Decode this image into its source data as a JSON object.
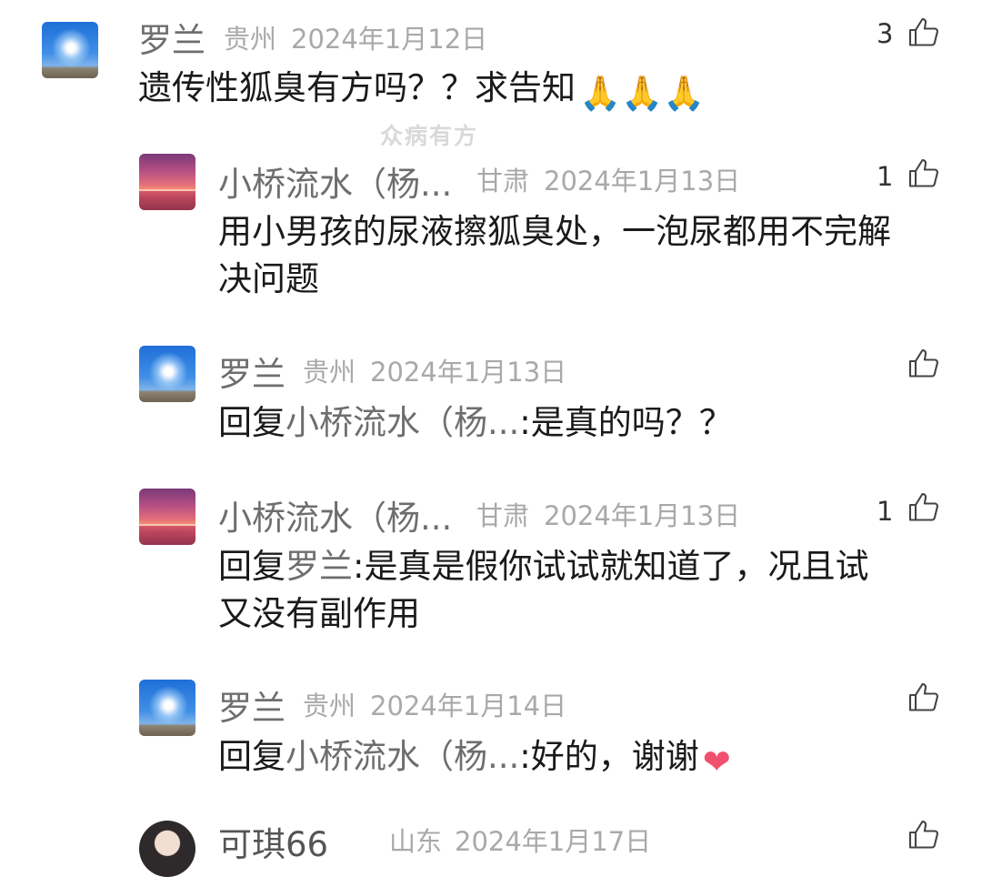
{
  "watermark": "众病有方",
  "comments": [
    {
      "name": "罗兰",
      "location": "贵州",
      "date": "2024年1月12日",
      "likes": "3",
      "text": "遗传性狐臭有方吗？？求告知",
      "emoji": "🙏🙏🙏"
    },
    {
      "name": "小桥流水（杨...",
      "location": "甘肃",
      "date": "2024年1月13日",
      "likes": "1",
      "text_line1": "用小男孩的尿液擦狐臭处，一泡尿都用不完解",
      "text_line2": "决问题"
    },
    {
      "name": "罗兰",
      "location": "贵州",
      "date": "2024年1月13日",
      "likes": "",
      "reply_prefix": "回复",
      "reply_to": "小桥流水（杨...",
      "text": ":是真的吗？？"
    },
    {
      "name": "小桥流水（杨...",
      "location": "甘肃",
      "date": "2024年1月13日",
      "likes": "1",
      "reply_prefix": "回复",
      "reply_to": "罗兰",
      "text_line1": ":是真是假你试试就知道了，况且试",
      "text_line2": "又没有副作用"
    },
    {
      "name": "罗兰",
      "location": "贵州",
      "date": "2024年1月14日",
      "likes": "",
      "reply_prefix": "回复",
      "reply_to": "小桥流水（杨...",
      "text": ":好的，谢谢",
      "emoji": "❤"
    },
    {
      "name": "可琪66",
      "location": "山东",
      "date": "2024年1月17日"
    }
  ],
  "icons": {
    "thumb": "thumbs-up-icon"
  }
}
